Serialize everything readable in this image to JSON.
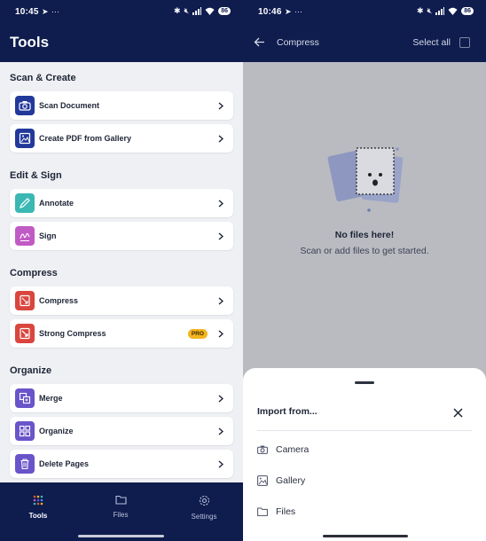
{
  "left": {
    "status": {
      "time": "10:45",
      "battery": "86"
    },
    "title": "Tools",
    "sections": [
      {
        "heading": "Scan & Create",
        "items": [
          {
            "label": "Scan Document"
          },
          {
            "label": "Create PDF from Gallery"
          }
        ]
      },
      {
        "heading": "Edit & Sign",
        "items": [
          {
            "label": "Annotate"
          },
          {
            "label": "Sign"
          }
        ]
      },
      {
        "heading": "Compress",
        "items": [
          {
            "label": "Compress"
          },
          {
            "label": "Strong Compress",
            "badge": "PRO"
          }
        ]
      },
      {
        "heading": "Organize",
        "items": [
          {
            "label": "Merge"
          },
          {
            "label": "Organize"
          },
          {
            "label": "Delete Pages"
          }
        ]
      }
    ],
    "nav": [
      {
        "label": "Tools",
        "icon": "grid-dots-icon"
      },
      {
        "label": "Files",
        "icon": "folder-icon"
      },
      {
        "label": "Settings",
        "icon": "gear-icon"
      }
    ]
  },
  "right": {
    "status": {
      "time": "10:46",
      "battery": "86"
    },
    "title": "Compress",
    "select_all": "Select all",
    "empty": {
      "title": "No files here!",
      "subtitle": "Scan or add files to get started."
    },
    "sheet": {
      "title": "Import from...",
      "options": [
        {
          "label": "Camera",
          "icon": "camera-icon"
        },
        {
          "label": "Gallery",
          "icon": "gallery-icon"
        },
        {
          "label": "Files",
          "icon": "folder-icon"
        }
      ]
    }
  },
  "colors": {
    "header": "#0e1c4e",
    "pro_badge": "#f4b51f",
    "scan_icon": "#22399a",
    "annotate_icon": "#3bb7b4",
    "sign_icon": "#c05bc5",
    "compress_icon": "#d9463e",
    "organize_icon": "#6a54c9"
  }
}
